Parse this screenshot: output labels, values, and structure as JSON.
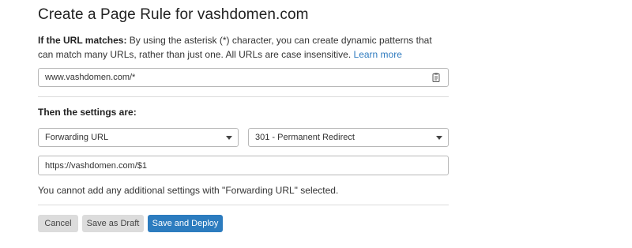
{
  "header": {
    "title": "Create a Page Rule for vashdomen.com"
  },
  "url_match": {
    "label": "If the URL matches:",
    "description": " By using the asterisk (*) character, you can create dynamic patterns that can match many URLs, rather than just one. All URLs are case insensitive. ",
    "learn_more": "Learn more",
    "value": "www.vashdomen.com/*"
  },
  "settings": {
    "label": "Then the settings are:",
    "setting_select": "Forwarding URL",
    "status_select": "301 - Permanent Redirect",
    "destination_value": "https://vashdomen.com/$1",
    "notice": "You cannot add any additional settings with \"Forwarding URL\" selected."
  },
  "actions": {
    "cancel": "Cancel",
    "save_draft": "Save as Draft",
    "save_deploy": "Save and Deploy"
  },
  "colors": {
    "primary": "#2c7cbf",
    "link": "#2f7bbf",
    "secondary_button": "#dcdcdc"
  },
  "icons": {
    "url_input": "clipboard-icon",
    "select": "chevron-down-icon"
  }
}
